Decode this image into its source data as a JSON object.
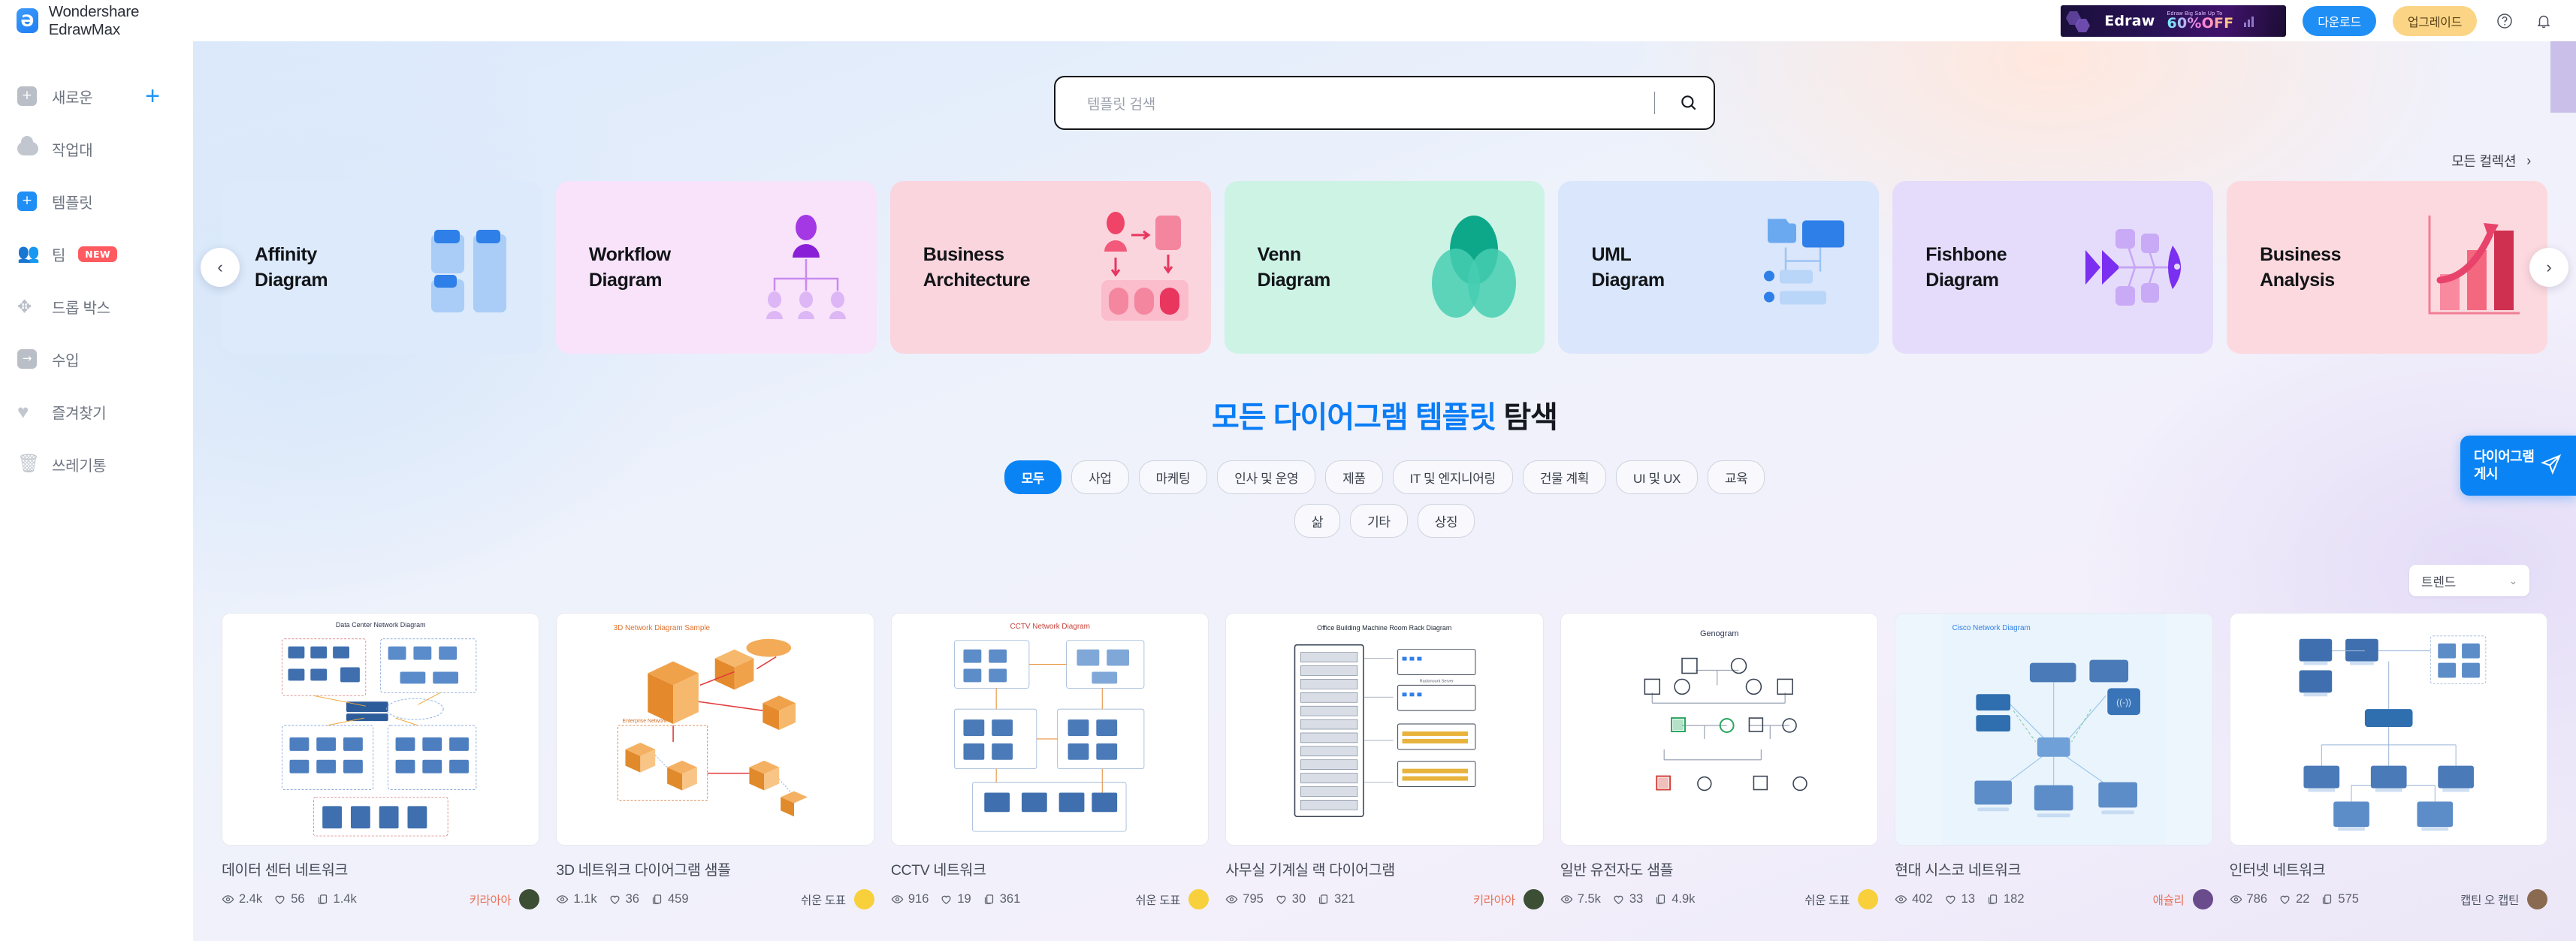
{
  "app": {
    "brand": "Wondershare EdrawMax",
    "logo_glyph": "Ə"
  },
  "sidebar": {
    "items": [
      {
        "label": "새로운",
        "icon": "new-document-icon",
        "has_plus": true
      },
      {
        "label": "작업대",
        "icon": "cloud-icon",
        "has_plus": false
      },
      {
        "label": "템플릿",
        "icon": "template-icon",
        "has_plus": false,
        "active": true
      },
      {
        "label": "팀",
        "icon": "team-icon",
        "badge": "NEW"
      },
      {
        "label": "드롭 박스",
        "icon": "dropbox-icon"
      },
      {
        "label": "수입",
        "icon": "import-icon"
      },
      {
        "label": "즐겨찾기",
        "icon": "heart-icon"
      },
      {
        "label": "쓰레기통",
        "icon": "trash-icon"
      }
    ]
  },
  "topbar": {
    "promo": {
      "brand": "Edraw",
      "tagline": "Edraw Big Sale Up To",
      "offer": "60%OFF"
    },
    "download_label": "다운로드",
    "upgrade_label": "업그레이드",
    "help_icon": "help-circle-icon",
    "bell_icon": "notification-bell-icon"
  },
  "search": {
    "placeholder": "템플릿 검색",
    "value": "",
    "icon": "search-icon"
  },
  "collections": {
    "link_label": "모든 컬렉션",
    "chevron": "›"
  },
  "carousel": {
    "prev_label": "‹",
    "next_label": "›",
    "cards": [
      {
        "title_line1": "Affinity",
        "title_line2": "Diagram",
        "bg": "#dceafb",
        "accent": "#2f7fe8",
        "art": "affinity"
      },
      {
        "title_line1": "Workflow",
        "title_line2": "Diagram",
        "bg": "#f6e4fa",
        "accent": "#9a2fe0",
        "art": "workflow"
      },
      {
        "title_line1": "Business",
        "title_line2": "Architecture",
        "bg": "#fbd5dd",
        "accent": "#ef4468",
        "art": "business-architecture"
      },
      {
        "title_line1": "Venn",
        "title_line2": "Diagram",
        "bg": "#cdf3e5",
        "accent": "#13a98a",
        "art": "venn"
      },
      {
        "title_line1": "UML",
        "title_line2": "Diagram",
        "bg": "#d9e6fb",
        "accent": "#2f7fe8",
        "art": "uml"
      },
      {
        "title_line1": "Fishbone",
        "title_line2": "Diagram",
        "bg": "#e5dcfb",
        "accent": "#7b2ff0",
        "art": "fishbone"
      },
      {
        "title_line1": "Business",
        "title_line2": "Analysis",
        "bg": "#fcd9de",
        "accent": "#e8436a",
        "art": "business-analysis"
      }
    ]
  },
  "explore": {
    "blue_part": "모든 다이어그램 템플릿",
    "dark_part": "탐색"
  },
  "filters": {
    "row1": [
      "모두",
      "사업",
      "마케팅",
      "인사 및 운영",
      "제품",
      "IT 및 엔지니어링",
      "건물 계획",
      "UI 및 UX",
      "교육"
    ],
    "row2": [
      "삶",
      "기타",
      "상징"
    ],
    "active": "모두"
  },
  "sort": {
    "value": "트렌드",
    "chevron": "⌄"
  },
  "templates": [
    {
      "title": "데이터 센터 네트워크",
      "views": "2.4k",
      "likes": "56",
      "copies": "1.4k",
      "author": "키라아아",
      "author_color": "#e8735a",
      "avatar": "#3c4f35",
      "art": "datacenter"
    },
    {
      "title": "3D 네트워크 다이어그램 샘플",
      "views": "1.1k",
      "likes": "36",
      "copies": "459",
      "author": "쉬운 도표",
      "author_color": "#4a5160",
      "avatar": "#f7d03c",
      "art": "net3d"
    },
    {
      "title": "CCTV 네트워크",
      "views": "916",
      "likes": "19",
      "copies": "361",
      "author": "쉬운 도표",
      "author_color": "#4a5160",
      "avatar": "#f7d03c",
      "art": "cctv"
    },
    {
      "title": "사무실 기계실 랙 다이어그램",
      "views": "795",
      "likes": "30",
      "copies": "321",
      "author": "키라아아",
      "author_color": "#e8735a",
      "avatar": "#3c4f35",
      "art": "rack"
    },
    {
      "title": "일반 유전자도 샘플",
      "views": "7.5k",
      "likes": "33",
      "copies": "4.9k",
      "author": "쉬운 도표",
      "author_color": "#4a5160",
      "avatar": "#f7d03c",
      "art": "genogram"
    },
    {
      "title": "현대 시스코 네트워크",
      "views": "402",
      "likes": "13",
      "copies": "182",
      "author": "애슐리",
      "author_color": "#e8735a",
      "avatar": "#6a4b8c",
      "art": "cisco"
    },
    {
      "title": "인터넷 네트워크",
      "views": "786",
      "likes": "22",
      "copies": "575",
      "author": "캡틴 오 캡틴",
      "author_color": "#4a5160",
      "avatar": "#8a6a50",
      "art": "internet"
    }
  ],
  "template_thumb_captions": [
    "Data Center Network Diagram",
    "3D Network Diagram Sample",
    "CCTV Network Diagram",
    "Office Building Machine Room Rack Diagram",
    "Genogram",
    "Cisco Network Diagram",
    ""
  ],
  "publish": {
    "line1": "다이어그램",
    "line2": "게시",
    "icon": "send-icon"
  },
  "colors": {
    "accent": "#0a84f5",
    "upgrade": "#fbd585",
    "badge_new": "#ff5a5f",
    "text": "#454b57"
  }
}
